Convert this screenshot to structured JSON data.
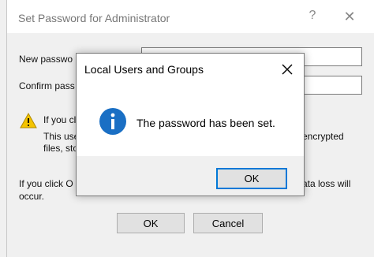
{
  "background_dialog": {
    "title": "Set Password for Administrator",
    "help_label": "?",
    "close_label": "✕",
    "new_password_label": "New passwo",
    "confirm_password_label": "Confirm pass",
    "warning_line1": "If you cl",
    "warning_line2": "This use",
    "warning_line2_right": "encrypted",
    "warning_line3": "files, sto",
    "info_line1": "If you click O",
    "info_line1_right": "ata loss will",
    "info_line2": "occur.",
    "ok_label": "OK",
    "cancel_label": "Cancel"
  },
  "message_box": {
    "title": "Local Users and Groups",
    "message": "The password has been set.",
    "ok_label": "OK"
  },
  "icons": {
    "warning": "warning-icon",
    "info": "info-icon",
    "close": "close-icon"
  },
  "colors": {
    "accent": "#0078d7",
    "info_icon": "#1a6fc4",
    "warning_icon": "#f4c400"
  }
}
